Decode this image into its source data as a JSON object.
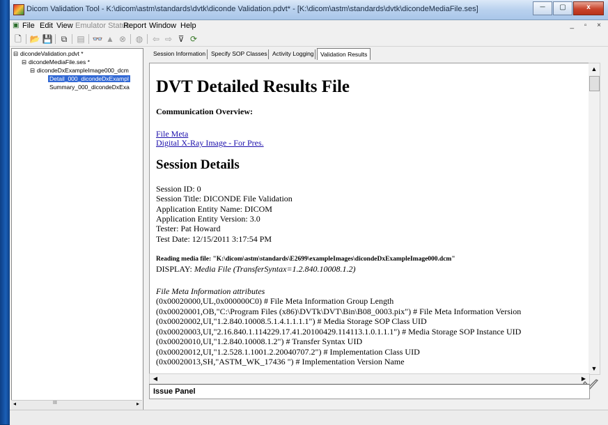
{
  "window": {
    "title": "Dicom Validation Tool - K:\\dicom\\astm\\standards\\dvtk\\diconde Validation.pdvt* - [K:\\dicom\\astm\\standards\\dvtk\\dicondeMediaFile.ses]",
    "minimize": "─",
    "maximize": "▢",
    "close": "x"
  },
  "menu": {
    "items": [
      "File",
      "Edit",
      "View",
      "Emulator Status",
      "Report",
      "Window",
      "Help"
    ],
    "mdi_controls": "_ ▫ ×"
  },
  "toolbar": {
    "icons": [
      "new-icon",
      "open-icon",
      "save-icon",
      "copy-icon",
      "document-icon",
      "binoculars-icon",
      "warning-icon",
      "stop-icon",
      "disk-icon",
      "back-arrow-icon",
      "forward-arrow-icon",
      "filter-icon",
      "refresh-icon"
    ],
    "glyphs": [
      "🗋",
      "📂",
      "💾",
      "⧉",
      "▤",
      "👓",
      "▲",
      "⊗",
      "◍",
      "⇦",
      "⇨",
      "⊽",
      "⟳"
    ]
  },
  "tree": {
    "nodes": [
      {
        "label": "dicondeValidation.pdvt *",
        "expander": "⊟"
      },
      {
        "label": "dicondeMediaFile.ses *",
        "expander": "⊟"
      },
      {
        "label": "dicondeDxExampleImage000_dcm",
        "expander": "⊟"
      },
      {
        "label": "Detail_000_dicondeDxExampl",
        "expander": ""
      },
      {
        "label": "Summary_000_dicondeDxExa",
        "expander": ""
      }
    ],
    "scroll_thumb": "III"
  },
  "tabs": [
    "Session Information",
    "Specify SOP Classes",
    "Activity Logging",
    "Validation Results"
  ],
  "report": {
    "title": "DVT Detailed Results File",
    "comm_overview": "Communication Overview:",
    "links": [
      "File Meta",
      "Digital X-Ray Image - For Pres."
    ],
    "session_details": "Session Details",
    "session_lines": [
      "Session ID: 0",
      "Session Title: DICONDE File Validation",
      "Application Entity Name: DICOM",
      "Application Entity Version: 3.0",
      "Tester: Pat Howard",
      "Test Date: 12/15/2011 3:17:54 PM"
    ],
    "reading_media": "Reading media file: \"K:\\dicom\\astm\\standards\\E2699\\exampleImages\\dicondeDxExampleImage000.dcm\"",
    "display_label": "DISPLAY:",
    "display_value": "Media File (TransferSyntax=1.2.840.10008.1.2)",
    "meta_heading": "File Meta Information attributes",
    "meta_lines": [
      "(0x00020000,UL,0x000000C0) # File Meta Information Group Length",
      "(0x00020001,OB,\"C:\\Program Files (x86)\\DVTk\\DVT\\Bin\\B08_0003.pix\") # File Meta Information Version",
      "(0x00020002,UI,\"1.2.840.10008.5.1.4.1.1.1.1\") # Media Storage SOP Class UID",
      "(0x00020003,UI,\"2.16.840.1.114229.17.41.20100429.114113.1.0.1.1.1\") # Media Storage SOP Instance UID",
      "(0x00020010,UI,\"1.2.840.10008.1.2\") # Transfer Syntax UID",
      "(0x00020012,UI,\"1.2.528.1.1001.2.20040707.2\") # Implementation Class UID",
      "(0x00020013,SH,\"ASTM_WK_17436 \") # Implementation Version Name"
    ]
  },
  "issue_panel": {
    "label": "Issue Panel"
  }
}
